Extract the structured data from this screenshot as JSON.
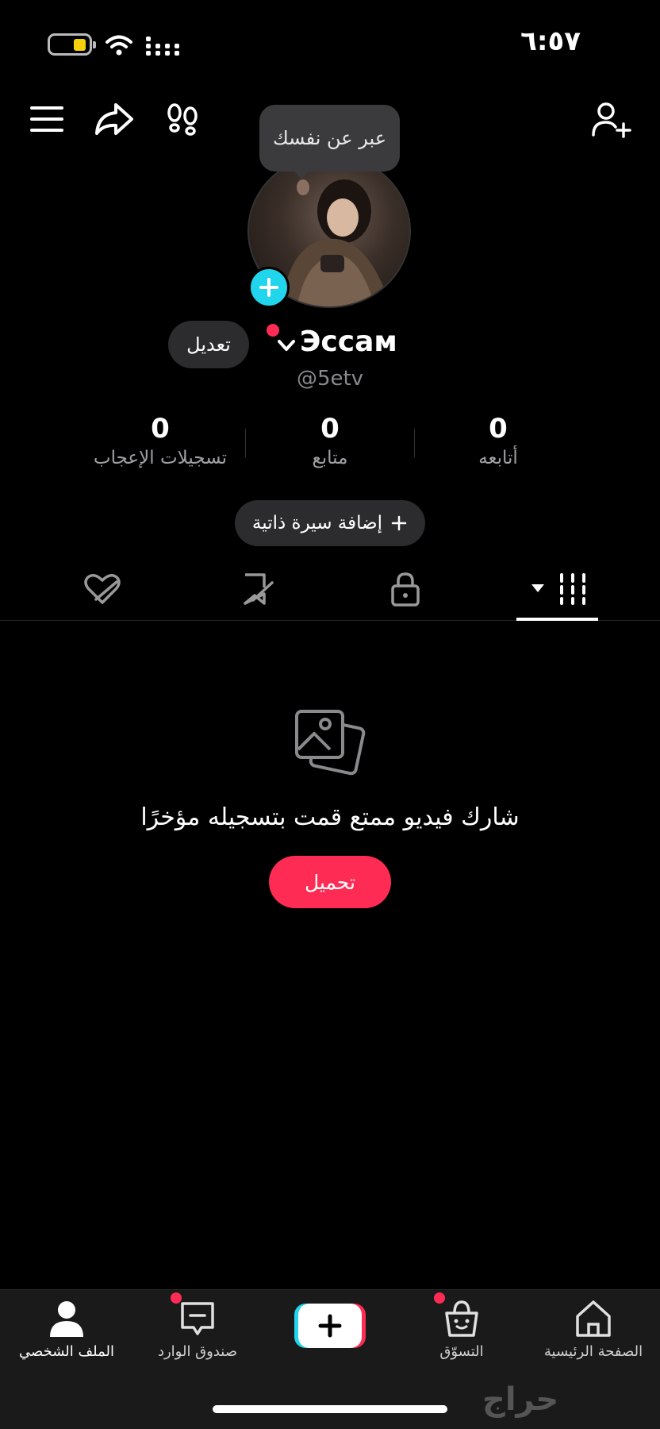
{
  "status_bar": {
    "time": "٦:٥٧"
  },
  "tooltip": {
    "text": "عبر عن نفسك"
  },
  "profile": {
    "display_name": "Эссам",
    "handle": "@5etv",
    "edit_label": "تعديل",
    "add_bio_label": "إضافة سيرة ذاتية"
  },
  "stats": [
    {
      "value": "0",
      "label": "أتابعه"
    },
    {
      "value": "0",
      "label": "متابع"
    },
    {
      "value": "0",
      "label": "تسجيلات الإعجاب"
    }
  ],
  "tabs": [
    {
      "icon": "videos-grid-icon",
      "active": true
    },
    {
      "icon": "lock-icon",
      "active": false
    },
    {
      "icon": "bookmark-hidden-icon",
      "active": false
    },
    {
      "icon": "liked-hidden-icon",
      "active": false
    }
  ],
  "empty_state": {
    "message": "شارك فيديو ممتع قمت بتسجيله مؤخرًا",
    "upload_label": "تحميل"
  },
  "bottom_nav": {
    "home": "الصفحة الرئيسية",
    "shop": "التسوّق",
    "inbox": "صندوق الوارد",
    "profile": "الملف الشخصي"
  },
  "watermark": "حراج",
  "colors": {
    "accent": "#fe2c55",
    "cyan": "#20d5ec",
    "background": "#000000"
  }
}
